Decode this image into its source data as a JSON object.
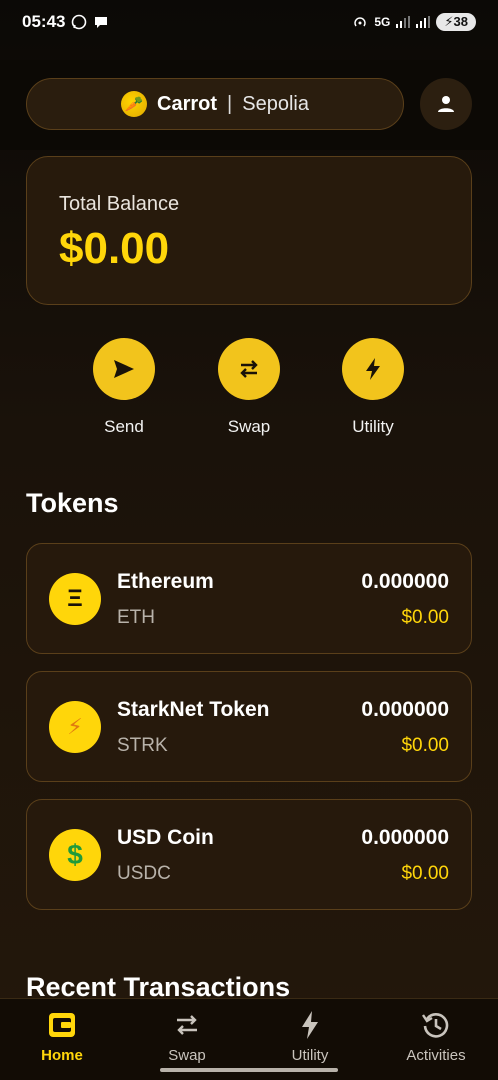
{
  "status": {
    "time": "05:43",
    "net_type": "5G",
    "battery": "38"
  },
  "header": {
    "app_name": "Carrot",
    "separator": "|",
    "network": "Sepolia"
  },
  "balance": {
    "label": "Total Balance",
    "value": "$0.00"
  },
  "actions": [
    {
      "label": "Send",
      "icon": "send-icon"
    },
    {
      "label": "Swap",
      "icon": "swap-icon"
    },
    {
      "label": "Utility",
      "icon": "bolt-icon"
    }
  ],
  "tokens_title": "Tokens",
  "tokens": [
    {
      "name": "Ethereum",
      "symbol": "ETH",
      "amount": "0.000000",
      "value": "$0.00",
      "glyph": "Ξ",
      "icon": "ethereum-icon"
    },
    {
      "name": "StarkNet Token",
      "symbol": "STRK",
      "amount": "0.000000",
      "value": "$0.00",
      "glyph": "⚡",
      "icon": "starknet-icon"
    },
    {
      "name": "USD Coin",
      "symbol": "USDC",
      "amount": "0.000000",
      "value": "$0.00",
      "glyph": "$",
      "icon": "usd-coin-icon"
    }
  ],
  "recent_title": "Recent Transactions",
  "nav": [
    {
      "label": "Home",
      "icon": "wallet-icon",
      "active": true
    },
    {
      "label": "Swap",
      "icon": "swap-icon",
      "active": false
    },
    {
      "label": "Utility",
      "icon": "bolt-icon",
      "active": false
    },
    {
      "label": "Activities",
      "icon": "history-icon",
      "active": false
    }
  ],
  "colors": {
    "accent": "#ffd60a",
    "action_circle": "#f2c41c",
    "card_border": "#5a3f1a",
    "card_bg": "#26190c"
  }
}
